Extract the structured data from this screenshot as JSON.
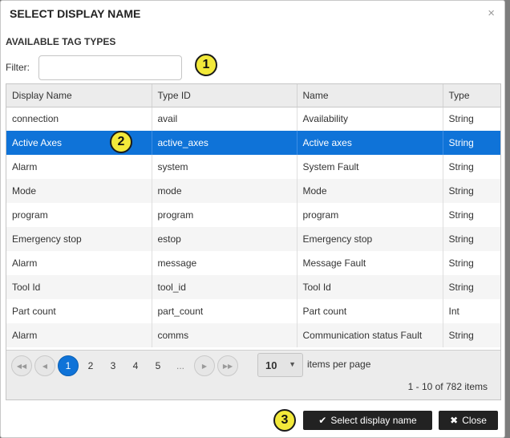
{
  "dialog": {
    "title": "SELECT DISPLAY NAME",
    "close_glyph": "×",
    "section_label": "AVAILABLE TAG TYPES",
    "filter_label": "Filter:",
    "filter_value": ""
  },
  "badges": [
    "1",
    "2",
    "3"
  ],
  "table": {
    "columns": [
      "Display Name",
      "Type ID",
      "Name",
      "Type"
    ],
    "selected_row": 1,
    "rows": [
      [
        "connection",
        "avail",
        "Availability",
        "String"
      ],
      [
        "Active Axes",
        "active_axes",
        "Active axes",
        "String"
      ],
      [
        "Alarm",
        "system",
        "System Fault",
        "String"
      ],
      [
        "Mode",
        "mode",
        "Mode",
        "String"
      ],
      [
        "program",
        "program",
        "program",
        "String"
      ],
      [
        "Emergency stop",
        "estop",
        "Emergency stop",
        "String"
      ],
      [
        "Alarm",
        "message",
        "Message Fault",
        "String"
      ],
      [
        "Tool Id",
        "tool_id",
        "Tool Id",
        "String"
      ],
      [
        "Part count",
        "part_count",
        "Part count",
        "Int"
      ],
      [
        "Alarm",
        "comms",
        "Communication status Fault",
        "String"
      ]
    ]
  },
  "pager": {
    "pages": [
      "1",
      "2",
      "3",
      "4",
      "5",
      "..."
    ],
    "active_page": "1",
    "per_page": "10",
    "per_page_label": "items per page",
    "info": "1 - 10 of 782 items",
    "icons": [
      "first-page-icon",
      "prev-page-icon",
      "next-page-icon",
      "last-page-icon"
    ]
  },
  "buttons": {
    "select_label": "Select display name",
    "select_icon": "✔",
    "close_label": "Close",
    "close_icon": "✖"
  },
  "colors": {
    "selected_row": "#0f73d8",
    "badge": "#f2e93a",
    "button": "#222222"
  }
}
